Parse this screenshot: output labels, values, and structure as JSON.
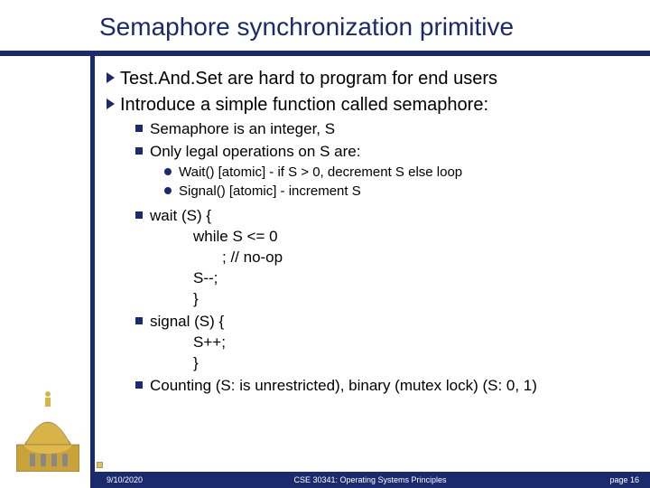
{
  "title": "Semaphore synchronization primitive",
  "bullets": {
    "l1a": "Test.And.Set are hard to program for end users",
    "l1b": "Introduce a simple function called semaphore:",
    "l2a": "Semaphore is an integer, S",
    "l2b": "Only legal operations on S are:",
    "l3a": "Wait() [atomic] - if S > 0, decrement S else loop",
    "l3b": "Signal() [atomic] - increment S",
    "l2c": "wait (S) {",
    "code1": "while S <= 0",
    "code2": "; // no-op",
    "code3": "S--;",
    "code4": "}",
    "l2d": "signal (S) {",
    "code5": "S++;",
    "code6": "}",
    "l2e": "Counting (S: is unrestricted), binary (mutex lock) (S: 0, 1)"
  },
  "footer": {
    "date": "9/10/2020",
    "course": "CSE 30341: Operating Systems Principles",
    "page": "page 16"
  }
}
